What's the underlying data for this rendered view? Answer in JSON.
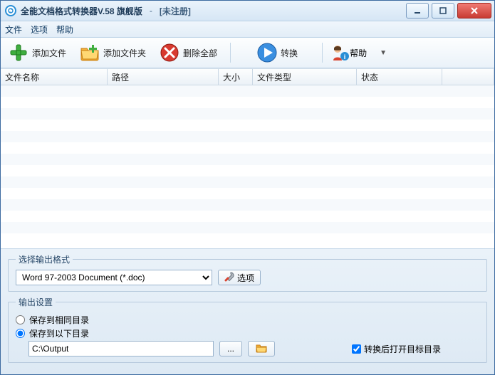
{
  "titlebar": {
    "app_title": "全能文档格式转换器V.58 旗舰版",
    "separator": "-",
    "registration": "[未注册]"
  },
  "menubar": {
    "file": "文件",
    "options": "选项",
    "help": "帮助"
  },
  "toolbar": {
    "add_file": "添加文件",
    "add_folder": "添加文件夹",
    "delete_all": "删除全部",
    "convert": "转换",
    "help": "帮助"
  },
  "columns": {
    "filename": "文件名称",
    "path": "路径",
    "size": "大小",
    "type": "文件类型",
    "status": "状态"
  },
  "output_format": {
    "legend": "选择输出格式",
    "selected": "Word 97-2003 Document (*.doc)",
    "options_btn": "选项"
  },
  "output_settings": {
    "legend": "输出设置",
    "same_dir": "保存到相同目录",
    "below_dir": "保存到以下目录",
    "path": "C:\\Output",
    "browse": "...",
    "open_after": "转换后打开目标目录"
  }
}
